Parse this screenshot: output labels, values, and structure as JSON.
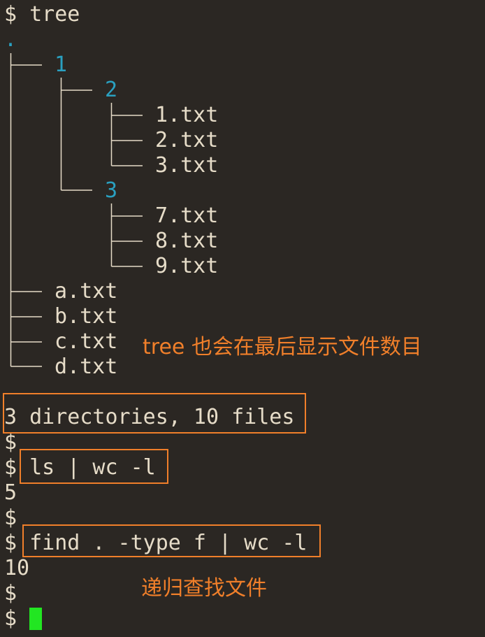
{
  "terminal": {
    "prompt": "$",
    "cmd_tree": "tree",
    "root": ".",
    "tree": {
      "dir1": "1",
      "dir2": "2",
      "dir3": "3",
      "f1": "1.txt",
      "f2": "2.txt",
      "f3": "3.txt",
      "f7": "7.txt",
      "f8": "8.txt",
      "f9": "9.txt",
      "fa": "a.txt",
      "fb": "b.txt",
      "fc": "c.txt",
      "fd": "d.txt"
    },
    "summary": "3 directories, 10 files",
    "cmd_ls": "ls | wc -l",
    "ls_result": "5",
    "cmd_find": "find . -type f | wc -l",
    "find_result": "10"
  },
  "annotations": {
    "tree_note": "tree 也会在最后显示文件数目",
    "find_note": "递归查找文件"
  },
  "colors": {
    "background": "#2b2723",
    "text": "#e6dcc8",
    "directory": "#2aa0c0",
    "annotation": "#f07f2a",
    "cursor": "#22e622"
  }
}
